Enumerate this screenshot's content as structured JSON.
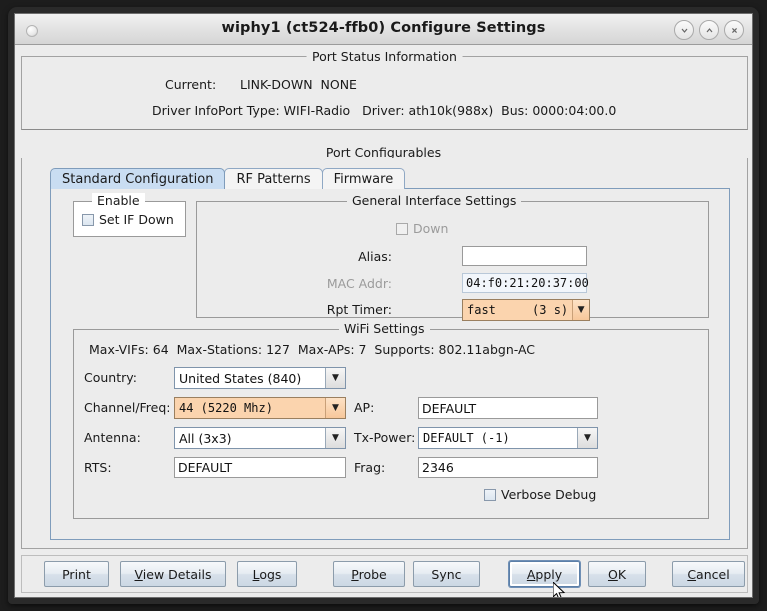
{
  "window": {
    "title": "wiphy1  (ct524-ffb0) Configure Settings",
    "buttons": {
      "minimize": "⌄",
      "maximize": "⌃",
      "close": "✕"
    }
  },
  "port_status": {
    "legend": "Port Status Information",
    "current_label": "Current:",
    "current_value": "LINK-DOWN  NONE",
    "driver_label": "Driver Info:",
    "driver_value": "Port Type: WIFI-Radio   Driver: ath10k(988x)  Bus: 0000:04:00.0"
  },
  "port_configurables": {
    "legend": "Port Configurables",
    "tabs": [
      {
        "label": "Standard Configuration",
        "active": true
      },
      {
        "label": "RF Patterns",
        "active": false
      },
      {
        "label": "Firmware",
        "active": false
      }
    ]
  },
  "enable_group": {
    "legend": "Enable",
    "set_if_down_label": "Set IF Down",
    "set_if_down_checked": false
  },
  "general_interface": {
    "legend": "General Interface Settings",
    "down_label": "Down",
    "down_checked": false,
    "alias_label": "Alias:",
    "alias_value": "",
    "alias_placeholder": "",
    "mac_label": "MAC Addr:",
    "mac_value": "04:f0:21:20:37:00",
    "rpt_timer_label": "Rpt Timer:",
    "rpt_timer_value": "fast     (3 s)"
  },
  "wifi_settings": {
    "legend": "WiFi Settings",
    "caps_line": "Max-VIFs: 64  Max-Stations: 127  Max-APs: 7  Supports: 802.11abgn-AC",
    "country_label": "Country:",
    "country_value": "United States (840)",
    "channel_label": "Channel/Freq:",
    "channel_value": "44 (5220 Mhz)",
    "ap_label": "AP:",
    "ap_value": "DEFAULT",
    "antenna_label": "Antenna:",
    "antenna_value": "All (3x3)",
    "txpower_label": "Tx-Power:",
    "txpower_value": "DEFAULT (-1)",
    "rts_label": "RTS:",
    "rts_value": "DEFAULT",
    "frag_label": "Frag:",
    "frag_value": "2346",
    "verbose_debug_label": "Verbose Debug",
    "verbose_debug_checked": false
  },
  "footer": {
    "print": "Print",
    "view_details": "View Details",
    "view_details_mnemonic": "V",
    "logs": "Logs",
    "logs_mnemonic": "L",
    "probe": "Probe",
    "probe_mnemonic": "P",
    "sync": "Sync",
    "apply": "Apply",
    "apply_mnemonic": "A",
    "ok": "OK",
    "ok_mnemonic": "O",
    "cancel": "Cancel",
    "cancel_mnemonic": "C"
  },
  "colors": {
    "modified_field": "#fbd4ae",
    "active_tab": "#c9ddf2",
    "window_bg": "#ececec"
  }
}
